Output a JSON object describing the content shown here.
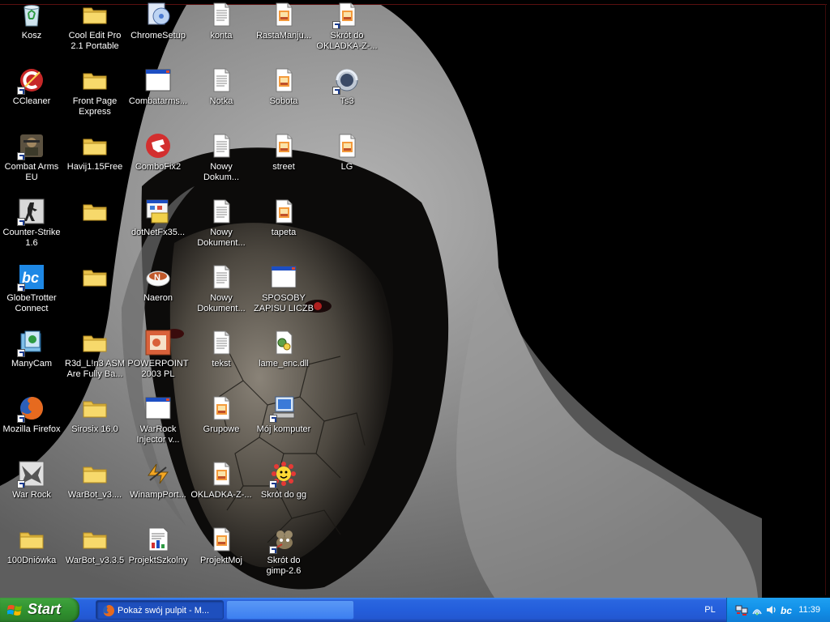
{
  "desktop": {
    "icons": [
      {
        "label": "Kosz",
        "icon": "recycle-bin-icon",
        "col": 0,
        "row": 0,
        "shortcut": false
      },
      {
        "label": "CCleaner",
        "icon": "ccleaner-icon",
        "col": 0,
        "row": 1,
        "shortcut": true
      },
      {
        "label": "Combat Arms\nEU",
        "icon": "combat-arms-icon",
        "col": 0,
        "row": 2,
        "shortcut": true
      },
      {
        "label": "Counter-Strike\n1.6",
        "icon": "counter-strike-icon",
        "col": 0,
        "row": 3,
        "shortcut": true
      },
      {
        "label": "GlobeTrotter\nConnect",
        "icon": "globetrotter-icon",
        "col": 0,
        "row": 4,
        "shortcut": true
      },
      {
        "label": "ManyCam",
        "icon": "manycam-icon",
        "col": 0,
        "row": 5,
        "shortcut": true
      },
      {
        "label": "Mozilla Firefox",
        "icon": "firefox-icon",
        "col": 0,
        "row": 6,
        "shortcut": true
      },
      {
        "label": "War Rock",
        "icon": "war-rock-icon",
        "col": 0,
        "row": 7,
        "shortcut": true
      },
      {
        "label": "100Dniówka",
        "icon": "folder-icon",
        "col": 0,
        "row": 8,
        "shortcut": false
      },
      {
        "label": "Cool Edit Pro\n2.1 Portable",
        "icon": "folder-icon",
        "col": 1,
        "row": 0,
        "shortcut": false
      },
      {
        "label": "Front Page\nExpress",
        "icon": "folder-icon",
        "col": 1,
        "row": 1,
        "shortcut": false
      },
      {
        "label": "Havij1.15Free",
        "icon": "folder-icon",
        "col": 1,
        "row": 2,
        "shortcut": false
      },
      {
        "label": "",
        "icon": "folder-icon",
        "col": 1,
        "row": 3,
        "shortcut": false
      },
      {
        "label": "",
        "icon": "folder-icon",
        "col": 1,
        "row": 4,
        "shortcut": false
      },
      {
        "label": "R3d_L!n3 ASM\nAre Fully Ba...",
        "icon": "folder-icon",
        "col": 1,
        "row": 5,
        "shortcut": false
      },
      {
        "label": "Sirosix 16.0",
        "icon": "folder-icon",
        "col": 1,
        "row": 6,
        "shortcut": false
      },
      {
        "label": "WarBot_v3....",
        "icon": "folder-icon",
        "col": 1,
        "row": 7,
        "shortcut": false
      },
      {
        "label": "WarBot_v3.3.5",
        "icon": "folder-icon",
        "col": 1,
        "row": 8,
        "shortcut": false
      },
      {
        "label": "ChromeSetup",
        "icon": "chrome-setup-icon",
        "col": 2,
        "row": 0,
        "shortcut": false
      },
      {
        "label": "Combatarms...",
        "icon": "application-window-icon",
        "col": 2,
        "row": 1,
        "shortcut": false
      },
      {
        "label": "ComboFix2",
        "icon": "combofix-icon",
        "col": 2,
        "row": 2,
        "shortcut": false
      },
      {
        "label": "dotNetFx35...",
        "icon": "installer-icon",
        "col": 2,
        "row": 3,
        "shortcut": false
      },
      {
        "label": "Naeron",
        "icon": "naeron-icon",
        "col": 2,
        "row": 4,
        "shortcut": false
      },
      {
        "label": "POWERPOINT\n2003 PL",
        "icon": "powerpoint-icon",
        "col": 2,
        "row": 5,
        "shortcut": false
      },
      {
        "label": "WarRock\nInjector v...",
        "icon": "application-window-icon",
        "col": 2,
        "row": 6,
        "shortcut": false
      },
      {
        "label": "WinampPort...",
        "icon": "winamp-icon",
        "col": 2,
        "row": 7,
        "shortcut": false
      },
      {
        "label": "ProjektSzkolny",
        "icon": "document-chart-icon",
        "col": 2,
        "row": 8,
        "shortcut": false
      },
      {
        "label": "konta",
        "icon": "text-document-icon",
        "col": 3,
        "row": 0,
        "shortcut": false
      },
      {
        "label": "Notka",
        "icon": "text-document-icon",
        "col": 3,
        "row": 1,
        "shortcut": false
      },
      {
        "label": "Nowy\nDokum...",
        "icon": "text-document-icon",
        "col": 3,
        "row": 2,
        "shortcut": false
      },
      {
        "label": "Nowy\nDokument...",
        "icon": "text-document-icon",
        "col": 3,
        "row": 3,
        "shortcut": false
      },
      {
        "label": "Nowy\nDokument...",
        "icon": "text-document-icon",
        "col": 3,
        "row": 4,
        "shortcut": false
      },
      {
        "label": "tekst",
        "icon": "text-document-icon",
        "col": 3,
        "row": 5,
        "shortcut": false
      },
      {
        "label": "Grupowe",
        "icon": "image-document-icon",
        "col": 3,
        "row": 6,
        "shortcut": false
      },
      {
        "label": "OKLADKA-Z-...",
        "icon": "image-document-icon",
        "col": 3,
        "row": 7,
        "shortcut": false
      },
      {
        "label": "ProjektMoj",
        "icon": "image-document-icon",
        "col": 3,
        "row": 8,
        "shortcut": false
      },
      {
        "label": "RastaManju...",
        "icon": "image-document-icon",
        "col": 4,
        "row": 0,
        "shortcut": false
      },
      {
        "label": "Sobota",
        "icon": "image-document-icon",
        "col": 4,
        "row": 1,
        "shortcut": false
      },
      {
        "label": "street",
        "icon": "image-document-icon",
        "col": 4,
        "row": 2,
        "shortcut": false
      },
      {
        "label": "tapeta",
        "icon": "image-document-icon",
        "col": 4,
        "row": 3,
        "shortcut": false
      },
      {
        "label": "SPOSOBY\nZAPISU LICZB",
        "icon": "application-window-icon",
        "col": 4,
        "row": 4,
        "shortcut": false
      },
      {
        "label": "lame_enc.dll",
        "icon": "dll-file-icon",
        "col": 4,
        "row": 5,
        "shortcut": false
      },
      {
        "label": "Mój komputer",
        "icon": "my-computer-icon",
        "col": 4,
        "row": 6,
        "shortcut": true
      },
      {
        "label": "Skrót do gg",
        "icon": "gadu-gadu-icon",
        "col": 4,
        "row": 7,
        "shortcut": true
      },
      {
        "label": "Skrót do\ngimp-2.6",
        "icon": "gimp-icon",
        "col": 4,
        "row": 8,
        "shortcut": true
      },
      {
        "label": "Skrót do\nOKLADKA-Z-...",
        "icon": "image-document-icon",
        "col": 5,
        "row": 0,
        "shortcut": true
      },
      {
        "label": "Ts3",
        "icon": "teamspeak-icon",
        "col": 5,
        "row": 1,
        "shortcut": true
      },
      {
        "label": "LG",
        "icon": "image-document-icon",
        "col": 5,
        "row": 2,
        "shortcut": false
      }
    ]
  },
  "taskbar": {
    "start_label": "Start",
    "tasks": [
      {
        "label": "Pokaż swój pulpit - M...",
        "icon": "firefox-icon",
        "active": true
      },
      {
        "label": "",
        "icon": "",
        "active": false
      }
    ],
    "language": "PL",
    "clock": "11:39",
    "tray_icons": [
      "network-icon",
      "wireless-icon",
      "volume-icon",
      "globetrotter-tray-icon"
    ]
  },
  "colors": {
    "taskbar_blue": "#245edb",
    "start_green": "#3c9f3a",
    "tray_blue": "#1290e8",
    "hoodie_gray": "#8a8a8a"
  }
}
